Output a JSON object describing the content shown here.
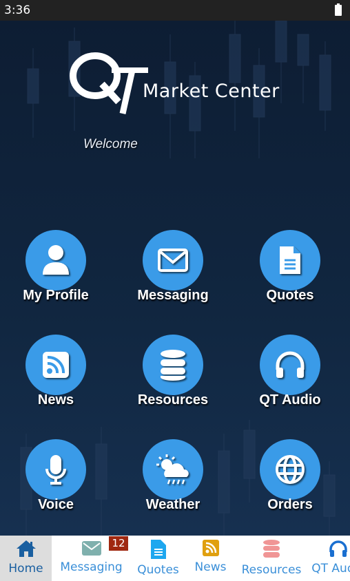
{
  "status_bar": {
    "time": "3:36"
  },
  "header": {
    "logo_text": "QT",
    "title": "Market Center",
    "welcome": "Welcome"
  },
  "tiles": [
    {
      "label": "My Profile",
      "icon": "user-icon"
    },
    {
      "label": "Messaging",
      "icon": "envelope-icon"
    },
    {
      "label": "Quotes",
      "icon": "document-icon"
    },
    {
      "label": "News",
      "icon": "rss-icon"
    },
    {
      "label": "Resources",
      "icon": "database-icon"
    },
    {
      "label": "QT Audio",
      "icon": "headphones-icon"
    },
    {
      "label": "Voice",
      "icon": "microphone-icon"
    },
    {
      "label": "Weather",
      "icon": "weather-icon"
    },
    {
      "label": "Orders",
      "icon": "globe-icon"
    }
  ],
  "tile_color": "#3a9be8",
  "bottom_nav": {
    "items": [
      {
        "label": "Home",
        "icon": "home-icon",
        "color": "#1a5fa0",
        "active": true
      },
      {
        "label": "Messaging",
        "icon": "envelope-icon",
        "color": "#7fb0ad",
        "badge": "12"
      },
      {
        "label": "Quotes",
        "icon": "document-icon",
        "color": "#1ea7ef"
      },
      {
        "label": "News",
        "icon": "rss-icon",
        "color": "#e0a010"
      },
      {
        "label": "Resources",
        "icon": "database-icon",
        "color": "#f09595"
      },
      {
        "label": "QT Audio",
        "icon": "headphones-icon",
        "color": "#1a6fd0"
      }
    ]
  }
}
